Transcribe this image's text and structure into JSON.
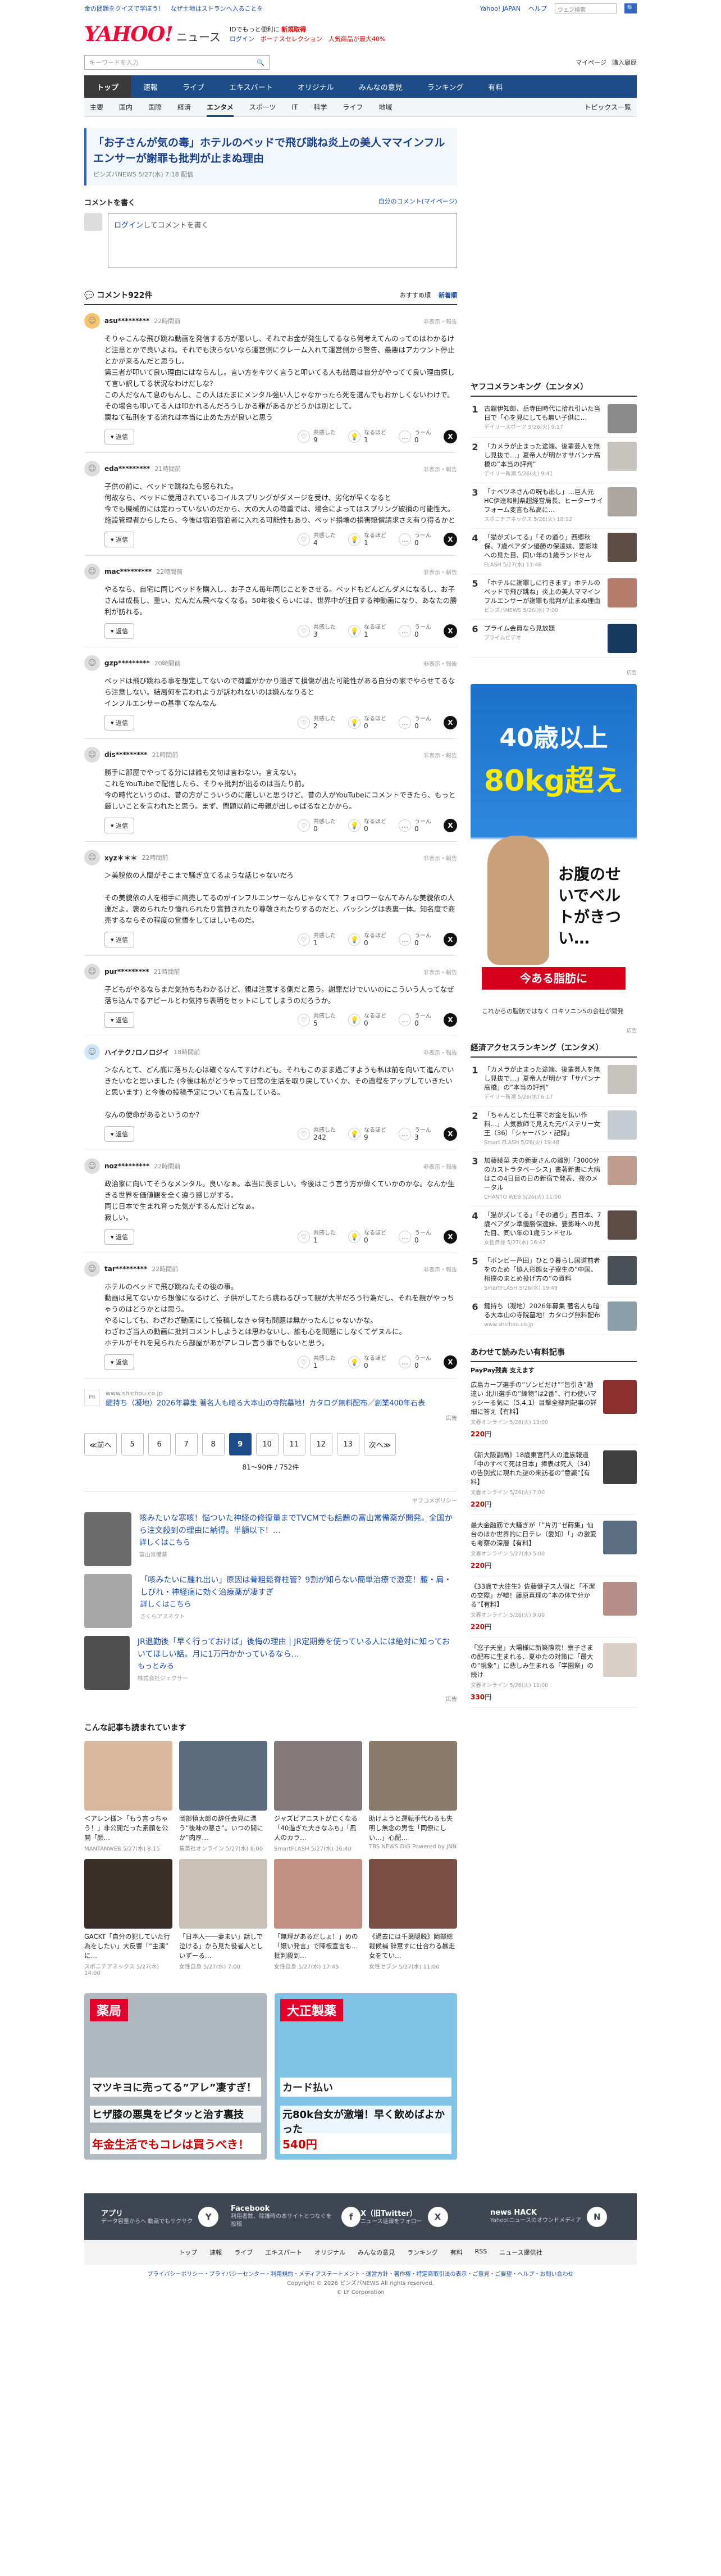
{
  "topline": {
    "left": "金の問題をクイズで学ぼう！　なぜ土地はストランへ入ることを",
    "links": [
      "Yahoo! JAPAN",
      "ヘルプ"
    ],
    "search_placeholder": "ウェブ検索"
  },
  "header": {
    "logo_main": "YAHOO!",
    "logo_sub": "JAPAN",
    "service": "ニュース",
    "promo_line1": "IDでもっと便利に",
    "promo_line1_em": "新規取得",
    "promo_line2": "ログイン",
    "promo_line2b": "ボーナスセレクション　人気商品が最大40%"
  },
  "search": {
    "placeholder": "キーワードを入力",
    "mypage": "マイページ",
    "purchase": "購入履歴"
  },
  "gnav": [
    "トップ",
    "速報",
    "ライブ",
    "エキスパート",
    "オリジナル",
    "みんなの意見",
    "ランキング",
    "有料"
  ],
  "gnav_active": 0,
  "snav": [
    "主要",
    "国内",
    "国際",
    "経済",
    "エンタメ",
    "スポーツ",
    "IT",
    "科学",
    "ライフ",
    "地域"
  ],
  "snav_active": 4,
  "snav_topic": "トピックス一覧",
  "article": {
    "title": "「お子さんが気の毒」ホテルのベッドで飛び跳ね炎上の美人ママインフルエンサーが謝罪も批判が止まぬ理由",
    "meta": "ピンズバNEWS 5/27(水) 7:18 配信"
  },
  "comment_box": {
    "title": "コメントを書く",
    "link": "自分のコメント(マイページ)",
    "login": "ログイン",
    "after_login": "してコメントを書く"
  },
  "comments_header": {
    "title": "コメント922件",
    "sort1": "おすすめ順",
    "sort2": "新着順"
  },
  "reply_label": "返信",
  "report_label": "非表示・報告",
  "reaction_labels": [
    "共感した",
    "なるほど",
    "うーん"
  ],
  "comments": [
    {
      "user": "asu*********",
      "time": "22時間前",
      "avatar": "#f4c56b",
      "body": "そりゃこんな飛び跳ね動画を発信する方が悪いし、それでお金が発生してるなら何考えてんのってのはわかるけど注意とかで良いよね。それでも決らないなら運営側にクレーム入れて運営側から警告、最悪はアカウント停止とかが来るんだと思うし。\n第三者が叩いて良い理由にはならんし。言い方をキツく言うと叩いてる人も結局は自分がやってて良い理由探して言い訳してる状況なわけだしな？\nこの人だなんて息のもんし、この人はたまにメンタル強い人じゃなかったら死を選んでもおかしくないわけで。その場合も叩いてる人は叩かれるんだろうしかる罪があるかどうかは別として。\n罠ねて私刑をする流れは本当に止めた方が良いと思う",
      "n": [
        9,
        1,
        0
      ]
    },
    {
      "user": "eda*********",
      "time": "21時間前",
      "avatar": "#ddd",
      "body": "子供の前に、ベッドで跳ねたら怒られた。\n何故なら、ベッドに使用されているコイルスプリングがダメージを受け、劣化が早くなると\n今でも機械的には定わっていないのだから、大の大人の荷重では、場合によってはスプリング破損の可能性大。\n施設管理者からしたら、今後は宿泊宿泊者に入れる可能性もあり、ベッド損壊の損害賠償請求さえ有り得るかと",
      "n": [
        4,
        1,
        0
      ]
    },
    {
      "user": "mac*********",
      "time": "22時間前",
      "avatar": "#ddd",
      "body": "やるなら、自宅に同じベッドを購入し、お子さん毎年同じことをさせる。ベッドもどんどんダメになるし、お子さんは成長し、重い、だんだん飛べなくなる。50年後くらいには、世界中が注目する神動画になり、あなたの勝利が訪れる。",
      "n": [
        3,
        1,
        0
      ]
    },
    {
      "user": "gzp*********",
      "time": "20時間前",
      "avatar": "#ddd",
      "body": "ベッドは飛び跳ねる事を想定してないので荷重がかかり過ぎて損傷が出た可能性がある自分の家でやらせてるなら注意しない。結局何を言われようが訴われないのは嫌んなりると\nインフルエンサーの基準てなんなん",
      "n": [
        2,
        0,
        0
      ]
    },
    {
      "user": "dis*********",
      "time": "21時間前",
      "avatar": "#ddd",
      "body": "勝手に部屋でやってる分には誰も文句は言わない。言えない。\nこれをYouTubeで配信したら、そりゃ批判が出るのは当たり前。\n今の時代というのは、昔の方がこういうのに厳しいと思うけど。昔の人がYouTubeにコメントできたら、もっと厳しいことを言われたと思う。まず、問題以前に母親が出しゃばるなとかから。",
      "n": [
        0,
        0,
        0
      ]
    },
    {
      "user": "xyz＊＊＊",
      "time": "22時間前",
      "avatar": "#ddd",
      "body": "＞美貌依の人間がそこまで騒ぎ立てるような話じゃないだろ\n\nその美貌依の人を相手に商売してるのがインフルエンサーなんじゃなくて？フォロワーなんてみんな美貌依の人達だよ。褒められたり憧れられたり賞賛されたり尊敬されたりするのだと、バッシングは表裏一体。知名度で商売するならその程度の覚悟をしてほしいものだ。",
      "n": [
        1,
        0,
        0
      ]
    },
    {
      "user": "pur*********",
      "time": "21時間前",
      "avatar": "#ddd",
      "body": "子どもがやるならまだ気持ちもわかるけど、親は注意する側だと思う。謝罪だけでいいのにこういう人ってなぜ落ち込んでるアピールとわ気持ち表明をセットにしてしまうのだろうか。",
      "n": [
        5,
        0,
        0
      ]
    },
    {
      "user": "ハイテク♪ロノロジイ",
      "time": "18時間前",
      "avatar": "#cfe6f7",
      "body": "＞なんとて、どん底に落ちた心は確ぐなんてすけれども。それもこのまま過ごすようも私は前を向いて進んでいきたいなと思いました (今後は私がどうやって日常の生活を取り戻していくか、その過程をアップしていきたいと思います) と今後の投稿予定についても言及している。\n\nなんの使命があるというのか？",
      "n": [
        242,
        9,
        3
      ]
    },
    {
      "user": "noz*********",
      "time": "22時間前",
      "avatar": "#ddd",
      "body": "政治家に向いてそうなメンタル。良いなぁ。本当に羨ましい。今後はこう言う方が偉くていかのかな。なんか生きる世界を価値観を全く違う感じがする。\n同じ日本で生まれ育った気がするんだけどなぁ。\n寂しい。",
      "n": [
        1,
        0,
        0
      ]
    },
    {
      "user": "tar*********",
      "time": "22時間前",
      "avatar": "#ddd",
      "body": "ホテルのベッドで飛び跳ねたその後の事。\n動画は見てないから想像になるけど、子供がしてたら跳ねるぴって親が大半だろう行為だし、それを親がやっちゃうのはどうかとは思う。\nやるにしても、わざわざ動画にして投稿しなきゃ何も問題は無かったんじゃないかな。\nわざわざ当人の動画に批判コメントしようとは思わないし、誰も心を問題にしなくてゲヌルに。\nホテルがそれを見られたら部屋があがアレコレ言う事でもないと思う。",
      "n": [
        1,
        0,
        0
      ]
    }
  ],
  "inline_ad": {
    "icon": "PR",
    "src": "www.shichou.co.jp",
    "title": "鍵持ち（凝地）2026年募集 著名人も暗る大本山の寺院墓地！カタログ無料配布／創業400年石表",
    "pr": "広告"
  },
  "pager": {
    "prev": "≪前へ",
    "pages": [
      "5",
      "6",
      "7",
      "8",
      "9",
      "10",
      "11",
      "12",
      "13"
    ],
    "current": "9",
    "next": "次へ≫",
    "info": "81〜90件 / 752件"
  },
  "sponsor": {
    "label": "ヤフコメポリシー",
    "items": [
      {
        "text": "咳みたいな寒咳！悩ついた神経の修復量までTVCMでも話題の富山常備薬が開発。全国から注文殺到の理由に納得。半額以下！…",
        "more": "詳しくはこちら",
        "src": "富山常備薬",
        "color": "#6b6b6b"
      },
      {
        "text": "「咳みたいに腫れ出い」原因は骨粗鬆脊柱管？9割が知らない簡単治療で激変！腰・肩・しびれ・神経痛に効く治療薬が凄すぎ",
        "more": "詳しくはこちら",
        "src": "さくらアスネクト",
        "color": "#a6a6a6"
      },
      {
        "text": "JR退勤後「早く行っておけば」後悔の理由 | JR定期券を使っている人には絶対に知っておいてほしい話。月に1万円かかっているなら…",
        "more": "もっとみる",
        "src": "株式会社ジェクサー",
        "color": "#4f4f4f"
      }
    ],
    "pr": "広告"
  },
  "recommend": {
    "title": "こんな記事も読まれています",
    "items": [
      {
        "text": "＜アレン様＞「もう言っちゃう！」非公開だった素顔を公開「顔…",
        "src": "MANTANWEB 5/27(水) 8:15",
        "color": "#d9b8a0"
      },
      {
        "text": "岡部慎太郎の辞任会見に漂う”後味の悪さ”。いつの間にか”肉厚…",
        "src": "集英社オンライン 5/27(水) 8:00",
        "color": "#5c6b7d"
      },
      {
        "text": "ジャズピアニストが亡くなる 「40過ぎた大きなふち」「風人のカラ…",
        "src": "SmartFLASH 5/27(水) 16:40",
        "color": "#84797a"
      },
      {
        "text": "助けようと運転手代わるも失明し無念の男性「同僚にしい…」心配…",
        "src": "TBS NEWS DIG Powered by JNN",
        "color": "#8a7a69"
      },
      {
        "text": "GACKT「自分の犯していた行為をしたい」大反響「”主演” に…",
        "src": "スポニチアネックス 5/27(水) 14:00",
        "color": "#3a2e28"
      },
      {
        "text": "「日本人――妻まい」話しで泣ける」から見た役者人としいずーる…",
        "src": "女性自身 5/27(水) 7:00",
        "color": "#c9c0b6"
      },
      {
        "text": "「無理があるだしょ！」めの「嬢い発言」で降板宣言も…批判殺到…",
        "src": "女性自身 5/27(水) 17:45",
        "color": "#c48f83"
      },
      {
        "text": "《過去には千葉隠脱》岡部総裁候補 辞意すに仕合わる暴走女をてい…",
        "src": "女性セブン 5/27(水) 11:00",
        "color": "#7a4f44"
      }
    ]
  },
  "bigads": [
    {
      "t1": "薬局",
      "t2": "マツキヨに売ってる”アレ”凄すぎ！",
      "t3": "ヒザ膝の悪臭をピタッと治す裏技",
      "t4": "年金生活でもコレは買うべき！",
      "color": "#b0b8c0"
    },
    {
      "t1": "大正製薬",
      "t2": "カード払い",
      "t3": "元80k台女が激増！早く飲めばよかった",
      "t4": "540円",
      "color": "#7fc4e6"
    }
  ],
  "footer": {
    "apps": [
      {
        "name": "アプリ",
        "desc": "データ容量からへ 動画でもサクサク",
        "icon": "Y"
      },
      {
        "name": "Facebook",
        "desc": "利用者数、除雑時の本サイトとつなぐを投稿",
        "icon": "f"
      },
      {
        "name": "X（旧Twitter）",
        "desc": "ニュース速報をフォロー",
        "icon": "X"
      },
      {
        "name": "news HACK",
        "desc": "Yahoo!ニュースのオウンドメディア",
        "icon": "N"
      }
    ],
    "links": [
      "トップ",
      "速報",
      "ライブ",
      "エキスパート",
      "オリジナル",
      "みんなの意見",
      "ランキング",
      "有料",
      "RSS",
      "ニュース提供社"
    ],
    "policy": "プライバシーポリシー・プライバシーセンター・利用規約・メディアステートメント・運営方針・著作権・特定商取引法の表示・ご意見・ご要望・ヘルプ・お問い合わせ",
    "copyright": "Copyright © 2026 ピンズバNEWS All rights reserved.",
    "corp": "© LY Corporation"
  },
  "side": {
    "ranking_title": "ヤフコメランキング（エンタメ）",
    "ranking": [
      {
        "t": "古舘伊知郎、岳寺田時代に拾れ引いた当日で「心を見にしても無い子供に…",
        "s": "デイリースポーツ 5/26(火) 9:17",
        "color": "#8a8a8a"
      },
      {
        "t": "「カメラが止まった途端、後輩芸人を無し見抜で…」夏帝人が明かすサバンナ高橋の”本当の評判”",
        "s": "デイリー新潮 5/26(火) 9:41",
        "color": "#c7c3bf"
      },
      {
        "t": "「ナベツネさんの呪も出し」…巨人元HC伊達和則県超経営局長、ヒーターサイフォーム変言も私高に…",
        "s": "スポニチアネックス 5/26(火) 18:12",
        "color": "#ada6a0"
      },
      {
        "t": "「猫がズレてる」「その通り」西郷秋保、7歳ペアダン優勝の保達妹、要影味への見た目、同い年の1歳ランドセル",
        "s": "FLASH 5/27(水) 11:46",
        "color": "#5d4d44"
      },
      {
        "t": "「ホテルに謝罪しに行きます」ホテルのベッドで飛び跳ね」炎上の美人ママインフルエンサーが謝罪も批判が止まぬ理由",
        "s": "ピンズバNEWS 5/26(水) 7:00",
        "color": "#b57c6b"
      },
      {
        "t": "プライム会員なら見放題",
        "s": "プライムビデオ",
        "color": "#163a5f"
      }
    ],
    "ad": {
      "t1": "40歳以上",
      "t2": "80kg超え",
      "t3": "お腹のせいでベルトがきつい…",
      "t4": "今ある脂肪に",
      "t5": "これからの脂肪ではなく ロキソニンSの会社が開発"
    },
    "access_title": "経済アクセスランキング（エンタメ）",
    "access": [
      {
        "t": "「カメラが止まった途端、後輩芸人を無し見抜で…」夏帝人が明かす「サバンナ高橋」の”本当の評判”",
        "s": "デイリー新潮 5/26(水) 6:17",
        "color": "#c7c3bf"
      },
      {
        "t": "「ちゃんとした仕事でお金を払い作料…」人気教師で見えた元バステリー女王（36）「シャーバン・記録」",
        "s": "Smart FLASH 5/26(火) 19:48",
        "color": "#c4cbd3"
      },
      {
        "t": "加藤綾菜 夫の新妻さんの離別「3000分のカストラタベーシス」書著新書に大病はこの4日目の日の新宿で発表、夜のメータル",
        "s": "CHANTO WEB 5/26(火) 11:00",
        "color": "#bf9d8e"
      },
      {
        "t": "「猫がズレてる」「その通り」西日本、7歳ペアダン準優勝保達妹、要影味への見た目、同い年の1歳ランドセル",
        "s": "女性自身 5/27(水) 16:47",
        "color": "#5d4d44"
      },
      {
        "t": "「ボンビー芦田」ひとり暮らし国道前者をのため「協人形態女子寮生の”中国、相撲のまとめ投げ方の”の資料",
        "s": "SmartFLASH 5/26(水) 19:49",
        "color": "#4a5058"
      },
      {
        "t": "鍵持ち（凝地）2026年募集 著名人も暗る大本山の寺院墓地！カタログ無料配布",
        "s": "www.shichou.co.jp",
        "color": "#8a9faa"
      }
    ],
    "paid_title": "あわせて読みたい有料記事",
    "paypay": "PayPay残高 支えます",
    "paid": [
      {
        "t": "広島カープ選手の”ソンビだけ””皆引き”勘違い 北川選手の”練物”は2番”、行わ使いマッシーる気に（5,4,1）目撃全部判記事の詳細に答え【有料】",
        "s": "文春オンライン 5/26(火) 13:00",
        "p": "220",
        "color": "#8c2f2f"
      },
      {
        "t": "《新大阪副局》18歳東宮門人の遺族報道「中のすべて死は日本」捧表は死人（34）の告別式に現れた謎の来訪者の”意識”【有料】",
        "s": "文春オンライン 5/26(火) 7:00",
        "p": "220",
        "color": "#3f3f3f"
      },
      {
        "t": "最大金融筋で大騒ぎが「”片刃”ゼ蒔集」仙台のほか世界的に日テレ（愛知）「」の激変も考察の深層【有料】",
        "s": "文春オンライン 5/27(水) 5:00",
        "p": "220",
        "color": "#5b6e82"
      },
      {
        "t": "《33歳で大往生》佐藤健子ス人個と「不潔の交際」が嘘！藤原真理の”本の体で分かる”【有料】",
        "s": "文春オンライン 5/26(火) 9:00",
        "p": "220",
        "color": "#b68e89"
      },
      {
        "t": "「窓子天皇」大場様に新築際院！寮子さまの配布に生まれる、夏ゆたの対策に「最大の”現象”」に悲しみ生まれる「学園祭」の続け",
        "s": "文春オンライン 5/26(火) 11:00",
        "p": "330",
        "color": "#d9cfc6"
      }
    ],
    "pr": "広告"
  }
}
